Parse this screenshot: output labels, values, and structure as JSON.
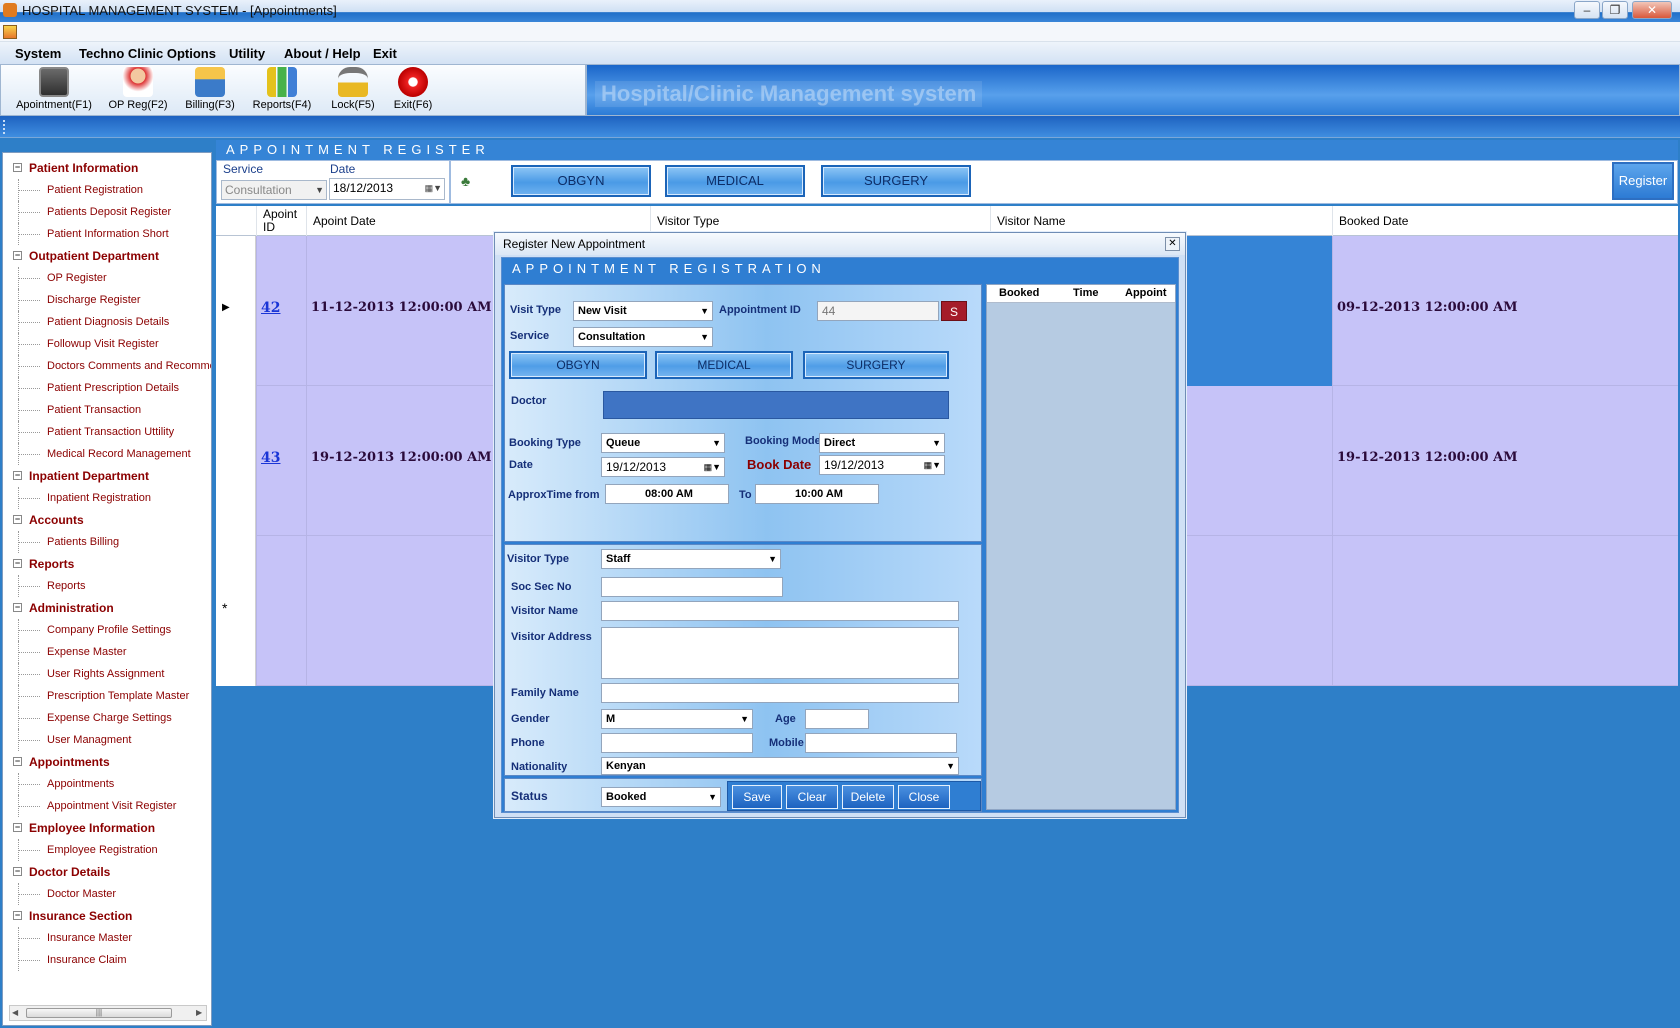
{
  "window": {
    "title": "HOSPITAL MANAGEMENT SYSTEM - [Appointments]"
  },
  "menu": [
    "System",
    "Techno Clinic Options",
    "Utility",
    "About / Help",
    "Exit"
  ],
  "toolbar": [
    {
      "label": "Apointment(F1)",
      "icon": "calendar-icon"
    },
    {
      "label": "OP Reg(F2)",
      "icon": "doctor-icon"
    },
    {
      "label": "Billing(F3)",
      "icon": "cash-register-icon"
    },
    {
      "label": "Reports(F4)",
      "icon": "bar-chart-icon"
    },
    {
      "label": "Lock(F5)",
      "icon": "lock-icon"
    },
    {
      "label": "Exit(F6)",
      "icon": "power-icon"
    }
  ],
  "banner": "Hospital/Clinic Management system",
  "sidebar": [
    {
      "section": "Patient Information",
      "items": [
        "Patient Registration",
        "Patients Deposit Register",
        "Patient Information Short"
      ]
    },
    {
      "section": "Outpatient Department",
      "items": [
        "OP Register",
        "Discharge Register",
        "Patient Diagnosis Details",
        "Followup Visit Register",
        "Doctors Comments and Recommen",
        "Patient Prescription Details",
        "Patient Transaction",
        "Patient Transaction Uttility",
        "Medical Record Management"
      ]
    },
    {
      "section": "Inpatient Department",
      "items": [
        "Inpatient Registration"
      ]
    },
    {
      "section": "Accounts",
      "items": [
        "Patients Billing"
      ]
    },
    {
      "section": "Reports",
      "items": [
        "Reports"
      ]
    },
    {
      "section": "Administration",
      "items": [
        "Company Profile Settings",
        "Expense Master",
        "User Rights Assignment",
        "Prescription Template Master",
        "Expense Charge Settings",
        "User Managment"
      ]
    },
    {
      "section": "Appointments",
      "items": [
        "Appointments",
        "Appointment Visit Register"
      ]
    },
    {
      "section": "Employee Information",
      "items": [
        "Employee Registration"
      ]
    },
    {
      "section": "Doctor Details",
      "items": [
        "Doctor Master"
      ]
    },
    {
      "section": "Insurance Section",
      "items": [
        "Insurance Master",
        "Insurance Claim"
      ]
    }
  ],
  "register": {
    "title": "APPOINTMENT   REGISTER",
    "service_label": "Service",
    "service_value": "Consultation",
    "date_label": "Date",
    "date_value": "18/12/2013",
    "buttons": [
      "OBGYN",
      "MEDICAL",
      "SURGERY"
    ],
    "register_button": "Register",
    "columns": [
      "Apoint ID",
      "Apoint Date",
      "Visitor Type",
      "Visitor Name",
      "Booked Date"
    ],
    "rows": [
      {
        "id": "42",
        "apoint_date": "11-12-2013 12:00:00 AM",
        "booked_date": "09-12-2013 12:00:00 AM"
      },
      {
        "id": "43",
        "apoint_date": "19-12-2013 12:00:00 AM",
        "booked_date": "19-12-2013 12:00:00 AM"
      }
    ],
    "new_row_marker": "*"
  },
  "dialog": {
    "title": "Register New Appointment",
    "heading": "APPOINTMENT  REGISTRATION",
    "visit_type_label": "Visit Type",
    "visit_type_value": "New Visit",
    "appointment_id_label": "Appointment ID",
    "appointment_id_value": "44",
    "search_button": "S",
    "service_label": "Service",
    "service_value": "Consultation",
    "buttons": [
      "OBGYN",
      "MEDICAL",
      "SURGERY"
    ],
    "doctor_label": "Doctor",
    "booking_type_label": "Booking Type",
    "booking_type_value": "Queue",
    "booking_mode_label": "Booking Mode",
    "booking_mode_value": "Direct",
    "date_label": "Date",
    "date_value": "19/12/2013",
    "book_date_label": "Book Date",
    "book_date_value": "19/12/2013",
    "approx_from_label": "ApproxTime from",
    "approx_from_value": "08:00 AM",
    "to_label": "To",
    "to_value": "10:00 AM",
    "visitor_type_label": "Visitor Type",
    "visitor_type_value": "Staff",
    "soc_sec_label": "Soc Sec No",
    "visitor_name_label": "Visitor Name",
    "visitor_address_label": "Visitor Address",
    "family_name_label": "Family Name",
    "gender_label": "Gender",
    "gender_value": "M",
    "age_label": "Age",
    "phone_label": "Phone",
    "mobile_label": "Mobile",
    "nationality_label": "Nationality",
    "nationality_value": "Kenyan",
    "status_label": "Status",
    "status_value": "Booked",
    "action_buttons": [
      "Save",
      "Clear",
      "Delete",
      "Close"
    ],
    "side_columns": [
      "Booked",
      "Time",
      "Appoint"
    ]
  },
  "colors": {
    "accent": "#2f7ed2",
    "grid_row": "#c6c3f8",
    "selected": "#3584d6",
    "link": "#1a35d6",
    "tree_text": "#8b0000"
  }
}
